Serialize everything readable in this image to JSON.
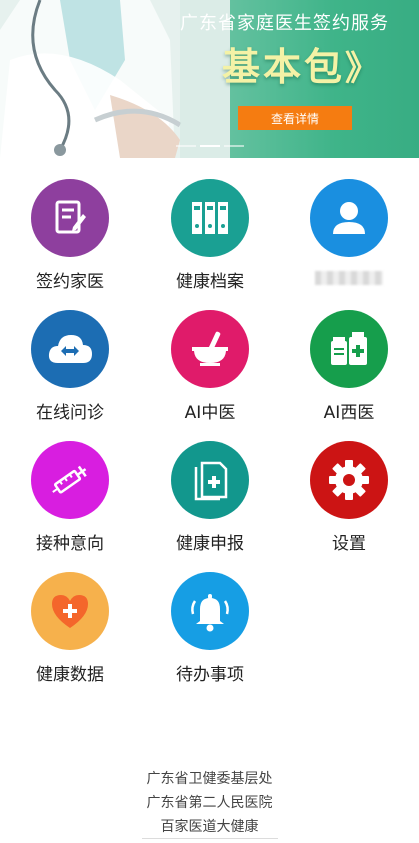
{
  "banner": {
    "title": "广东省家庭医生签约服务",
    "big_text": "基本包",
    "arrows": "》",
    "button_label": "查看详情",
    "slide_count": 3,
    "active_slide": 2
  },
  "menu": {
    "items": [
      {
        "label": "签约家医",
        "icon": "contract-icon",
        "color": "#8e3f9e"
      },
      {
        "label": "健康档案",
        "icon": "binders-icon",
        "color": "#1aa093"
      },
      {
        "label": "",
        "icon": "user-icon",
        "color": "#1a8fe0"
      },
      {
        "label": "在线问诊",
        "icon": "cloud-icon",
        "color": "#1c6db3"
      },
      {
        "label": "AI中医",
        "icon": "mortar-icon",
        "color": "#e01b6a"
      },
      {
        "label": "AI西医",
        "icon": "medicine-icon",
        "color": "#169e4c"
      },
      {
        "label": "接种意向",
        "icon": "syringe-icon",
        "color": "#d81ee0"
      },
      {
        "label": "健康申报",
        "icon": "report-icon",
        "color": "#12978d"
      },
      {
        "label": "设置",
        "icon": "gear-icon",
        "color": "#cc1414"
      },
      {
        "label": "健康数据",
        "icon": "heart-icon",
        "color": "#f6b14c"
      },
      {
        "label": "待办事项",
        "icon": "bell-icon",
        "color": "#169ee4"
      }
    ]
  },
  "footer": {
    "line1": "广东省卫健委基层处",
    "line2": "广东省第二人民医院",
    "line3": "百家医道大健康"
  }
}
